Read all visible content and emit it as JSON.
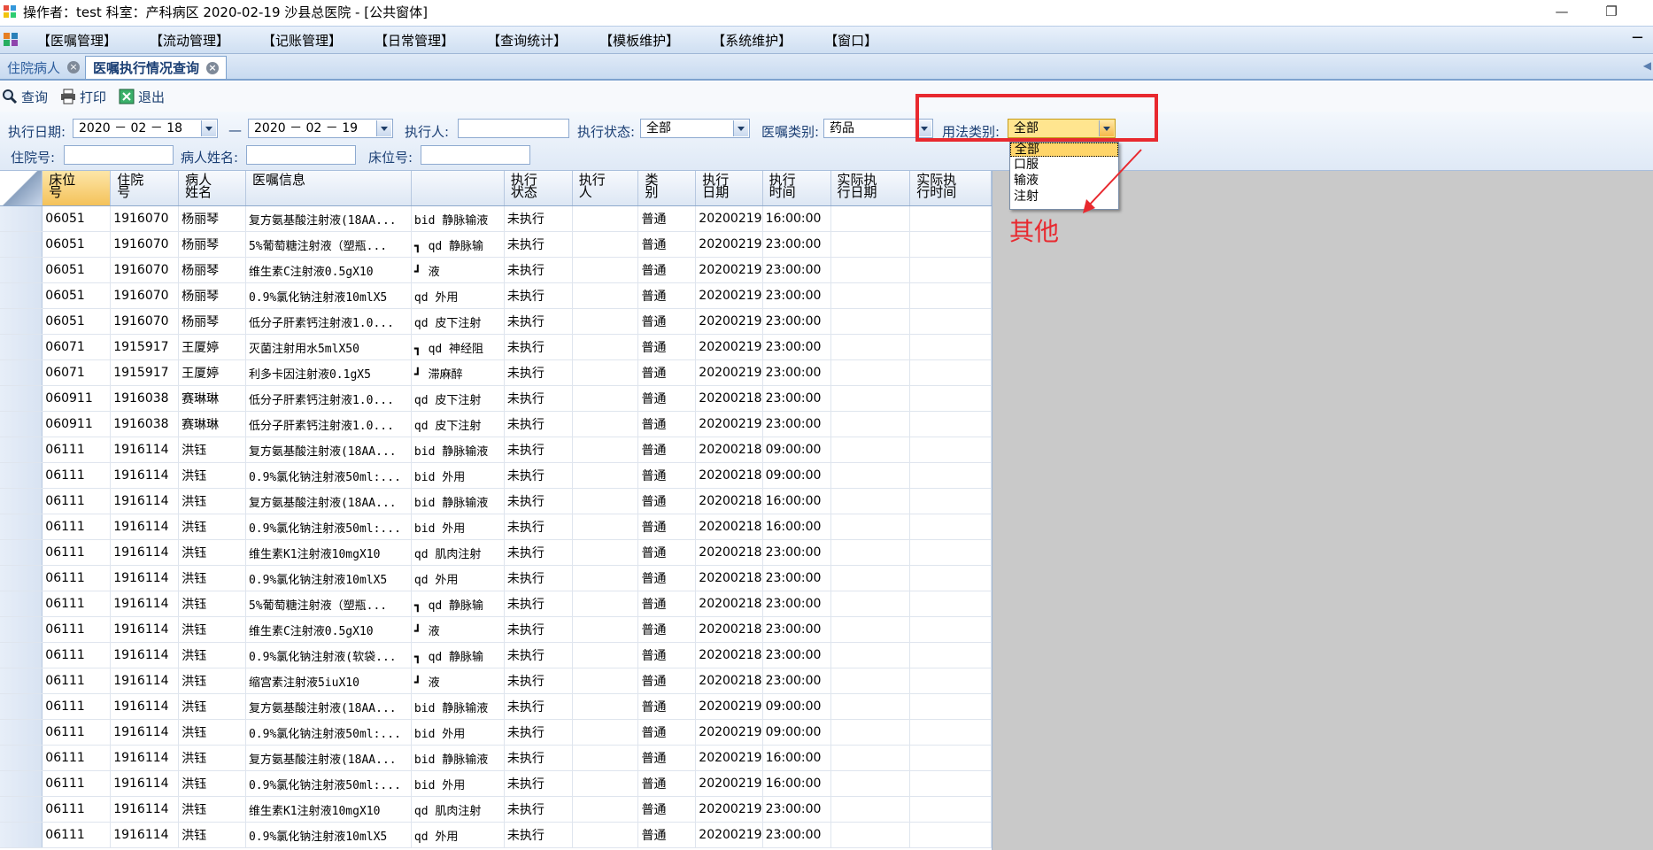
{
  "window": {
    "title": "操作者：test 科室：产科病区 2020-02-19 沙县总医院 - [公共窗体]",
    "minimize_glyph": "—",
    "restore_glyph": "❐"
  },
  "menu": {
    "items": [
      "【医嘱管理】",
      "【流动管理】",
      "【记账管理】",
      "【日常管理】",
      "【查询统计】",
      "【模板维护】",
      "【系统维护】",
      "【窗口】"
    ],
    "min_glyph": "−"
  },
  "tabs": [
    {
      "label": "住院病人",
      "close": "×"
    },
    {
      "label": "医嘱执行情况查询",
      "close": "×"
    }
  ],
  "toolbar": {
    "query": "查询",
    "print": "打印",
    "exit": "退出"
  },
  "filters": {
    "exec_date_label": "执行日期:",
    "date_from": "2020 － 02 － 18",
    "dash": "—",
    "date_to": "2020 － 02 － 19",
    "executor_label": "执行人:",
    "executor_value": "",
    "status_label": "执行状态:",
    "status_value": "全部",
    "order_type_label": "医嘱类别:",
    "order_type_value": "药品",
    "usage_label": "用法类别:",
    "usage_value": "全部",
    "inpatient_no_label": "住院号:",
    "inpatient_no_value": "",
    "patient_name_label": "病人姓名:",
    "patient_name_value": "",
    "bed_no_label": "床位号:",
    "bed_no_value": ""
  },
  "usage_options": [
    "全部",
    "口服",
    "输液",
    "注射"
  ],
  "annotation": "其他",
  "accent_color": "#e8292f",
  "table": {
    "columns": [
      "床位\n号",
      "住院\n号",
      "病人\n姓名",
      "医嘱信息",
      "",
      "执行\n状态",
      "执行\n人",
      "类\n别",
      "执行\n日期",
      "执行\n时间",
      "实际执\n行日期",
      "实际执\n行时间"
    ],
    "rows": [
      [
        "06051",
        "1916070",
        "杨丽琴",
        "复方氨基酸注射液(18AA...",
        "bid 静脉输液",
        "未执行",
        "",
        "普通",
        "20200219",
        "16:00:00",
        "",
        ""
      ],
      [
        "06051",
        "1916070",
        "杨丽琴",
        "5%葡萄糖注射液（塑瓶...",
        "┓ qd 静脉输",
        "未执行",
        "",
        "普通",
        "20200219",
        "23:00:00",
        "",
        ""
      ],
      [
        "06051",
        "1916070",
        "杨丽琴",
        "维生素C注射液0.5gX10",
        "┛ 液",
        "未执行",
        "",
        "普通",
        "20200219",
        "23:00:00",
        "",
        ""
      ],
      [
        "06051",
        "1916070",
        "杨丽琴",
        "0.9%氯化钠注射液10mlX5",
        "qd 外用",
        "未执行",
        "",
        "普通",
        "20200219",
        "23:00:00",
        "",
        ""
      ],
      [
        "06051",
        "1916070",
        "杨丽琴",
        "低分子肝素钙注射液1.0...",
        "qd 皮下注射",
        "未执行",
        "",
        "普通",
        "20200219",
        "23:00:00",
        "",
        ""
      ],
      [
        "06071",
        "1915917",
        "王厦婷",
        "灭菌注射用水5mlX50",
        "┓ qd 神经阻",
        "未执行",
        "",
        "普通",
        "20200219",
        "23:00:00",
        "",
        ""
      ],
      [
        "06071",
        "1915917",
        "王厦婷",
        "利多卡因注射液0.1gX5",
        "┛ 滞麻醉",
        "未执行",
        "",
        "普通",
        "20200219",
        "23:00:00",
        "",
        ""
      ],
      [
        "060911",
        "1916038",
        "赛琳琳",
        "低分子肝素钙注射液1.0...",
        "qd 皮下注射",
        "未执行",
        "",
        "普通",
        "20200218",
        "23:00:00",
        "",
        ""
      ],
      [
        "060911",
        "1916038",
        "赛琳琳",
        "低分子肝素钙注射液1.0...",
        "qd 皮下注射",
        "未执行",
        "",
        "普通",
        "20200219",
        "23:00:00",
        "",
        ""
      ],
      [
        "06111",
        "1916114",
        "洪钰",
        "复方氨基酸注射液(18AA...",
        "bid 静脉输液",
        "未执行",
        "",
        "普通",
        "20200218",
        "09:00:00",
        "",
        ""
      ],
      [
        "06111",
        "1916114",
        "洪钰",
        "0.9%氯化钠注射液50ml:...",
        "bid 外用",
        "未执行",
        "",
        "普通",
        "20200218",
        "09:00:00",
        "",
        ""
      ],
      [
        "06111",
        "1916114",
        "洪钰",
        "复方氨基酸注射液(18AA...",
        "bid 静脉输液",
        "未执行",
        "",
        "普通",
        "20200218",
        "16:00:00",
        "",
        ""
      ],
      [
        "06111",
        "1916114",
        "洪钰",
        "0.9%氯化钠注射液50ml:...",
        "bid 外用",
        "未执行",
        "",
        "普通",
        "20200218",
        "16:00:00",
        "",
        ""
      ],
      [
        "06111",
        "1916114",
        "洪钰",
        "维生素K1注射液10mgX10",
        "qd 肌肉注射",
        "未执行",
        "",
        "普通",
        "20200218",
        "23:00:00",
        "",
        ""
      ],
      [
        "06111",
        "1916114",
        "洪钰",
        "0.9%氯化钠注射液10mlX5",
        "qd 外用",
        "未执行",
        "",
        "普通",
        "20200218",
        "23:00:00",
        "",
        ""
      ],
      [
        "06111",
        "1916114",
        "洪钰",
        "5%葡萄糖注射液（塑瓶...",
        "┓ qd 静脉输",
        "未执行",
        "",
        "普通",
        "20200218",
        "23:00:00",
        "",
        ""
      ],
      [
        "06111",
        "1916114",
        "洪钰",
        "维生素C注射液0.5gX10",
        "┛ 液",
        "未执行",
        "",
        "普通",
        "20200218",
        "23:00:00",
        "",
        ""
      ],
      [
        "06111",
        "1916114",
        "洪钰",
        "0.9%氯化钠注射液(软袋...",
        "┓ qd 静脉输",
        "未执行",
        "",
        "普通",
        "20200218",
        "23:00:00",
        "",
        ""
      ],
      [
        "06111",
        "1916114",
        "洪钰",
        "缩宫素注射液5iuX10",
        "┛ 液",
        "未执行",
        "",
        "普通",
        "20200218",
        "23:00:00",
        "",
        ""
      ],
      [
        "06111",
        "1916114",
        "洪钰",
        "复方氨基酸注射液(18AA...",
        "bid 静脉输液",
        "未执行",
        "",
        "普通",
        "20200219",
        "09:00:00",
        "",
        ""
      ],
      [
        "06111",
        "1916114",
        "洪钰",
        "0.9%氯化钠注射液50ml:...",
        "bid 外用",
        "未执行",
        "",
        "普通",
        "20200219",
        "09:00:00",
        "",
        ""
      ],
      [
        "06111",
        "1916114",
        "洪钰",
        "复方氨基酸注射液(18AA...",
        "bid 静脉输液",
        "未执行",
        "",
        "普通",
        "20200219",
        "16:00:00",
        "",
        ""
      ],
      [
        "06111",
        "1916114",
        "洪钰",
        "0.9%氯化钠注射液50ml:...",
        "bid 外用",
        "未执行",
        "",
        "普通",
        "20200219",
        "16:00:00",
        "",
        ""
      ],
      [
        "06111",
        "1916114",
        "洪钰",
        "维生素K1注射液10mgX10",
        "qd 肌肉注射",
        "未执行",
        "",
        "普通",
        "20200219",
        "23:00:00",
        "",
        ""
      ],
      [
        "06111",
        "1916114",
        "洪钰",
        "0.9%氯化钠注射液10mlX5",
        "qd 外用",
        "未执行",
        "",
        "普通",
        "20200219",
        "23:00:00",
        "",
        ""
      ]
    ]
  }
}
